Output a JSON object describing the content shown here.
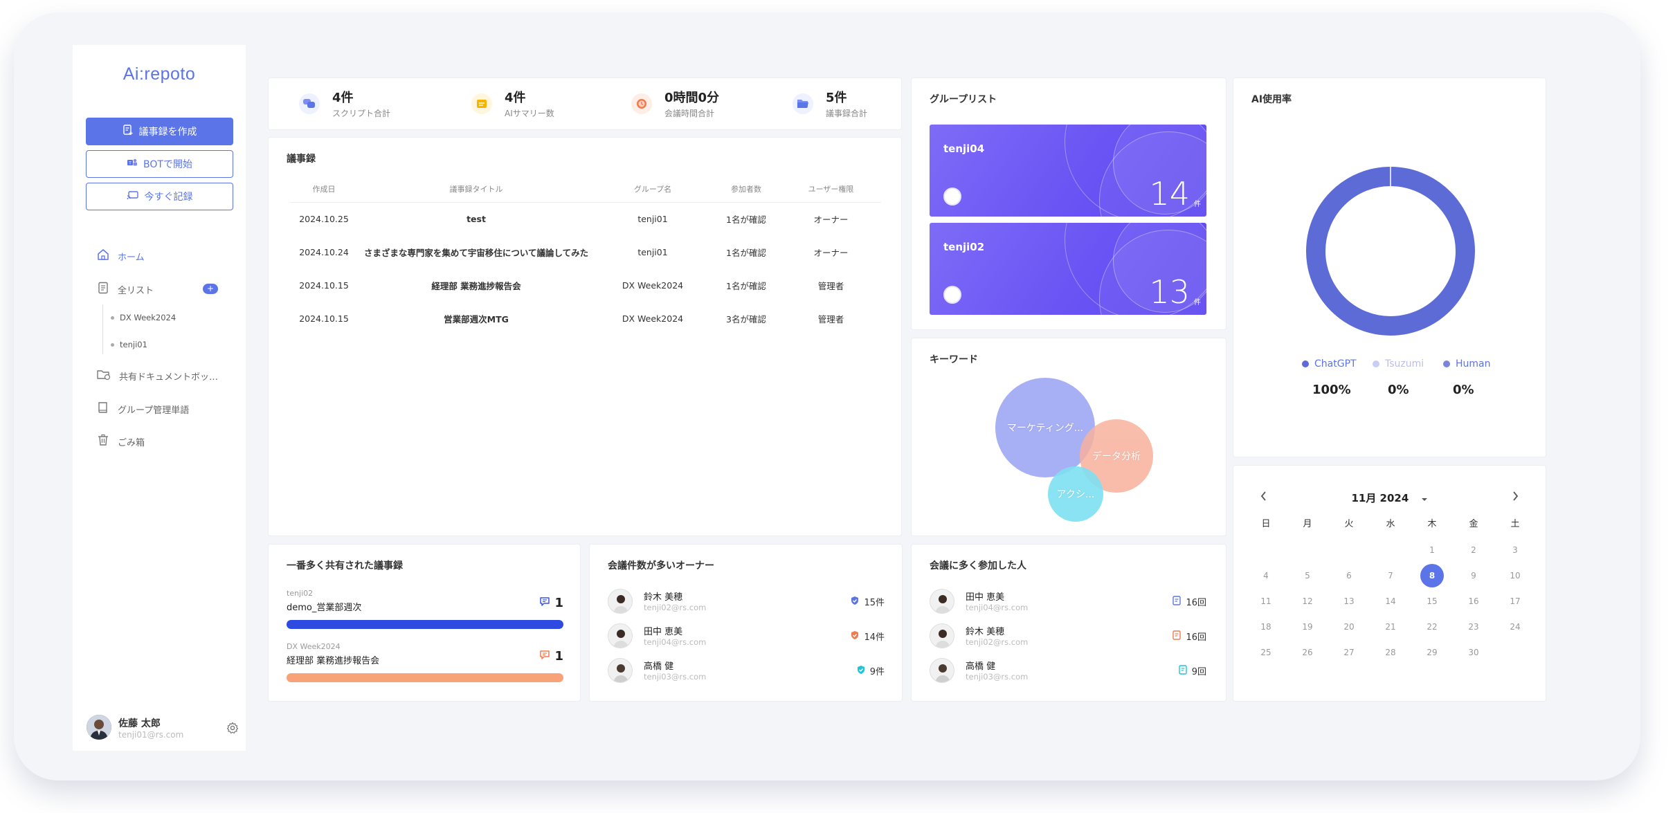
{
  "app": {
    "logo": "Ai:repoto"
  },
  "sidebar": {
    "create_btn": "議事録を作成",
    "bot_btn": "BOTで開始",
    "record_btn": "今すぐ記録",
    "nav": {
      "home": "ホーム",
      "all_list": "全リスト",
      "shared_docs": "共有ドキュメントボッ…",
      "group_vocab": "グループ管理単語",
      "trash": "ごみ箱"
    },
    "subitems": [
      "DX Week2024",
      "tenji01"
    ],
    "plus": "+",
    "user": {
      "name": "佐藤 太郎",
      "email": "tenji01@rs.com"
    }
  },
  "stats": [
    {
      "value": "4件",
      "label": "スクリプト合計",
      "icon": "chat-bubbles-icon",
      "color": "#5b74e8",
      "bg": "#eef1ff"
    },
    {
      "value": "4件",
      "label": "AIサマリー数",
      "icon": "summary-icon",
      "color": "#f5b400",
      "bg": "#fff6dd"
    },
    {
      "value": "0時間0分",
      "label": "会議時間合計",
      "icon": "clock-icon",
      "color": "#f07b4f",
      "bg": "#ffeee6"
    },
    {
      "value": "5件",
      "label": "議事録合計",
      "icon": "folder-icon",
      "color": "#5b74e8",
      "bg": "#eef1ff"
    }
  ],
  "minutes": {
    "title": "議事録",
    "headers": [
      "作成日",
      "議事録タイトル",
      "グループ名",
      "参加者数",
      "ユーザー権限"
    ],
    "rows": [
      {
        "date": "2024.10.25",
        "title": "test",
        "group": "tenji01",
        "participants": "1名が確認",
        "role": "オーナー",
        "role_link": true
      },
      {
        "date": "2024.10.24",
        "title": "さまざまな専門家を集めて宇宙移住について議論してみた",
        "group": "tenji01",
        "participants": "1名が確認",
        "role": "オーナー",
        "role_link": true
      },
      {
        "date": "2024.10.15",
        "title": "経理部 業務進捗報告会",
        "group": "DX Week2024",
        "participants": "1名が確認",
        "role": "管理者",
        "role_link": false
      },
      {
        "date": "2024.10.15",
        "title": "営業部週次MTG",
        "group": "DX Week2024",
        "participants": "3名が確認",
        "role": "管理者",
        "role_link": false
      }
    ]
  },
  "groups": {
    "title": "グループリスト",
    "items": [
      {
        "name": "tenji04",
        "count": "14",
        "unit": "件"
      },
      {
        "name": "tenji02",
        "count": "13",
        "unit": "件"
      }
    ]
  },
  "keywords": {
    "title": "キーワード",
    "items": [
      {
        "label": "マーケティング...",
        "color": "#9ea7f4"
      },
      {
        "label": "データ分析",
        "color": "#f8b19d"
      },
      {
        "label": "アクシ...",
        "color": "#7ee0f1"
      }
    ]
  },
  "ai_usage": {
    "title": "AI使用率",
    "legend": [
      {
        "name": "ChatGPT",
        "pct": "100%",
        "color": "#5c6bd6",
        "label_color": "#5b74e8"
      },
      {
        "name": "Tsuzumi",
        "pct": "0%",
        "color": "#c9cdf5",
        "label_color": "#b8bdf0"
      },
      {
        "name": "Human",
        "pct": "0%",
        "color": "#7a84dc",
        "label_color": "#5b74e8"
      }
    ]
  },
  "shared": {
    "title": "一番多く共有された議事録",
    "items": [
      {
        "group": "tenji02",
        "title": "demo_営業部週次",
        "count": "1",
        "color": "#2d4be0",
        "icon_color": "#3a55e6"
      },
      {
        "group": "DX Week2024",
        "title": "経理部 業務進捗報告会",
        "count": "1",
        "color": "#f8a27a",
        "icon_color": "#f07b4f"
      }
    ]
  },
  "owners": {
    "title": "会議件数が多いオーナー",
    "items": [
      {
        "name": "鈴木 美穂",
        "email": "tenji02@rs.com",
        "count": "15件",
        "icon_color": "#5b74e8"
      },
      {
        "name": "田中 恵美",
        "email": "tenji04@rs.com",
        "count": "14件",
        "icon_color": "#f07b4f"
      },
      {
        "name": "高橋 健",
        "email": "tenji03@rs.com",
        "count": "9件",
        "icon_color": "#20c4d8"
      }
    ]
  },
  "participants": {
    "title": "会議に多く参加した人",
    "items": [
      {
        "name": "田中 恵美",
        "email": "tenji04@rs.com",
        "count": "16回",
        "icon_color": "#5b74e8"
      },
      {
        "name": "鈴木 美穂",
        "email": "tenji02@rs.com",
        "count": "16回",
        "icon_color": "#f07b4f"
      },
      {
        "name": "高橋 健",
        "email": "tenji03@rs.com",
        "count": "9回",
        "icon_color": "#20c4d8"
      }
    ]
  },
  "calendar": {
    "header": "11月 2024",
    "dow": [
      "日",
      "月",
      "火",
      "水",
      "木",
      "金",
      "土"
    ],
    "today": "8",
    "weeks": [
      [
        "",
        "",
        "",
        "",
        "1",
        "2",
        "3"
      ],
      [
        "4",
        "5",
        "6",
        "7",
        "8",
        "9",
        "10"
      ],
      [
        "11",
        "12",
        "13",
        "14",
        "15",
        "16",
        "17"
      ],
      [
        "18",
        "19",
        "20",
        "21",
        "22",
        "23",
        "24"
      ],
      [
        "25",
        "26",
        "27",
        "28",
        "29",
        "30",
        ""
      ]
    ]
  }
}
